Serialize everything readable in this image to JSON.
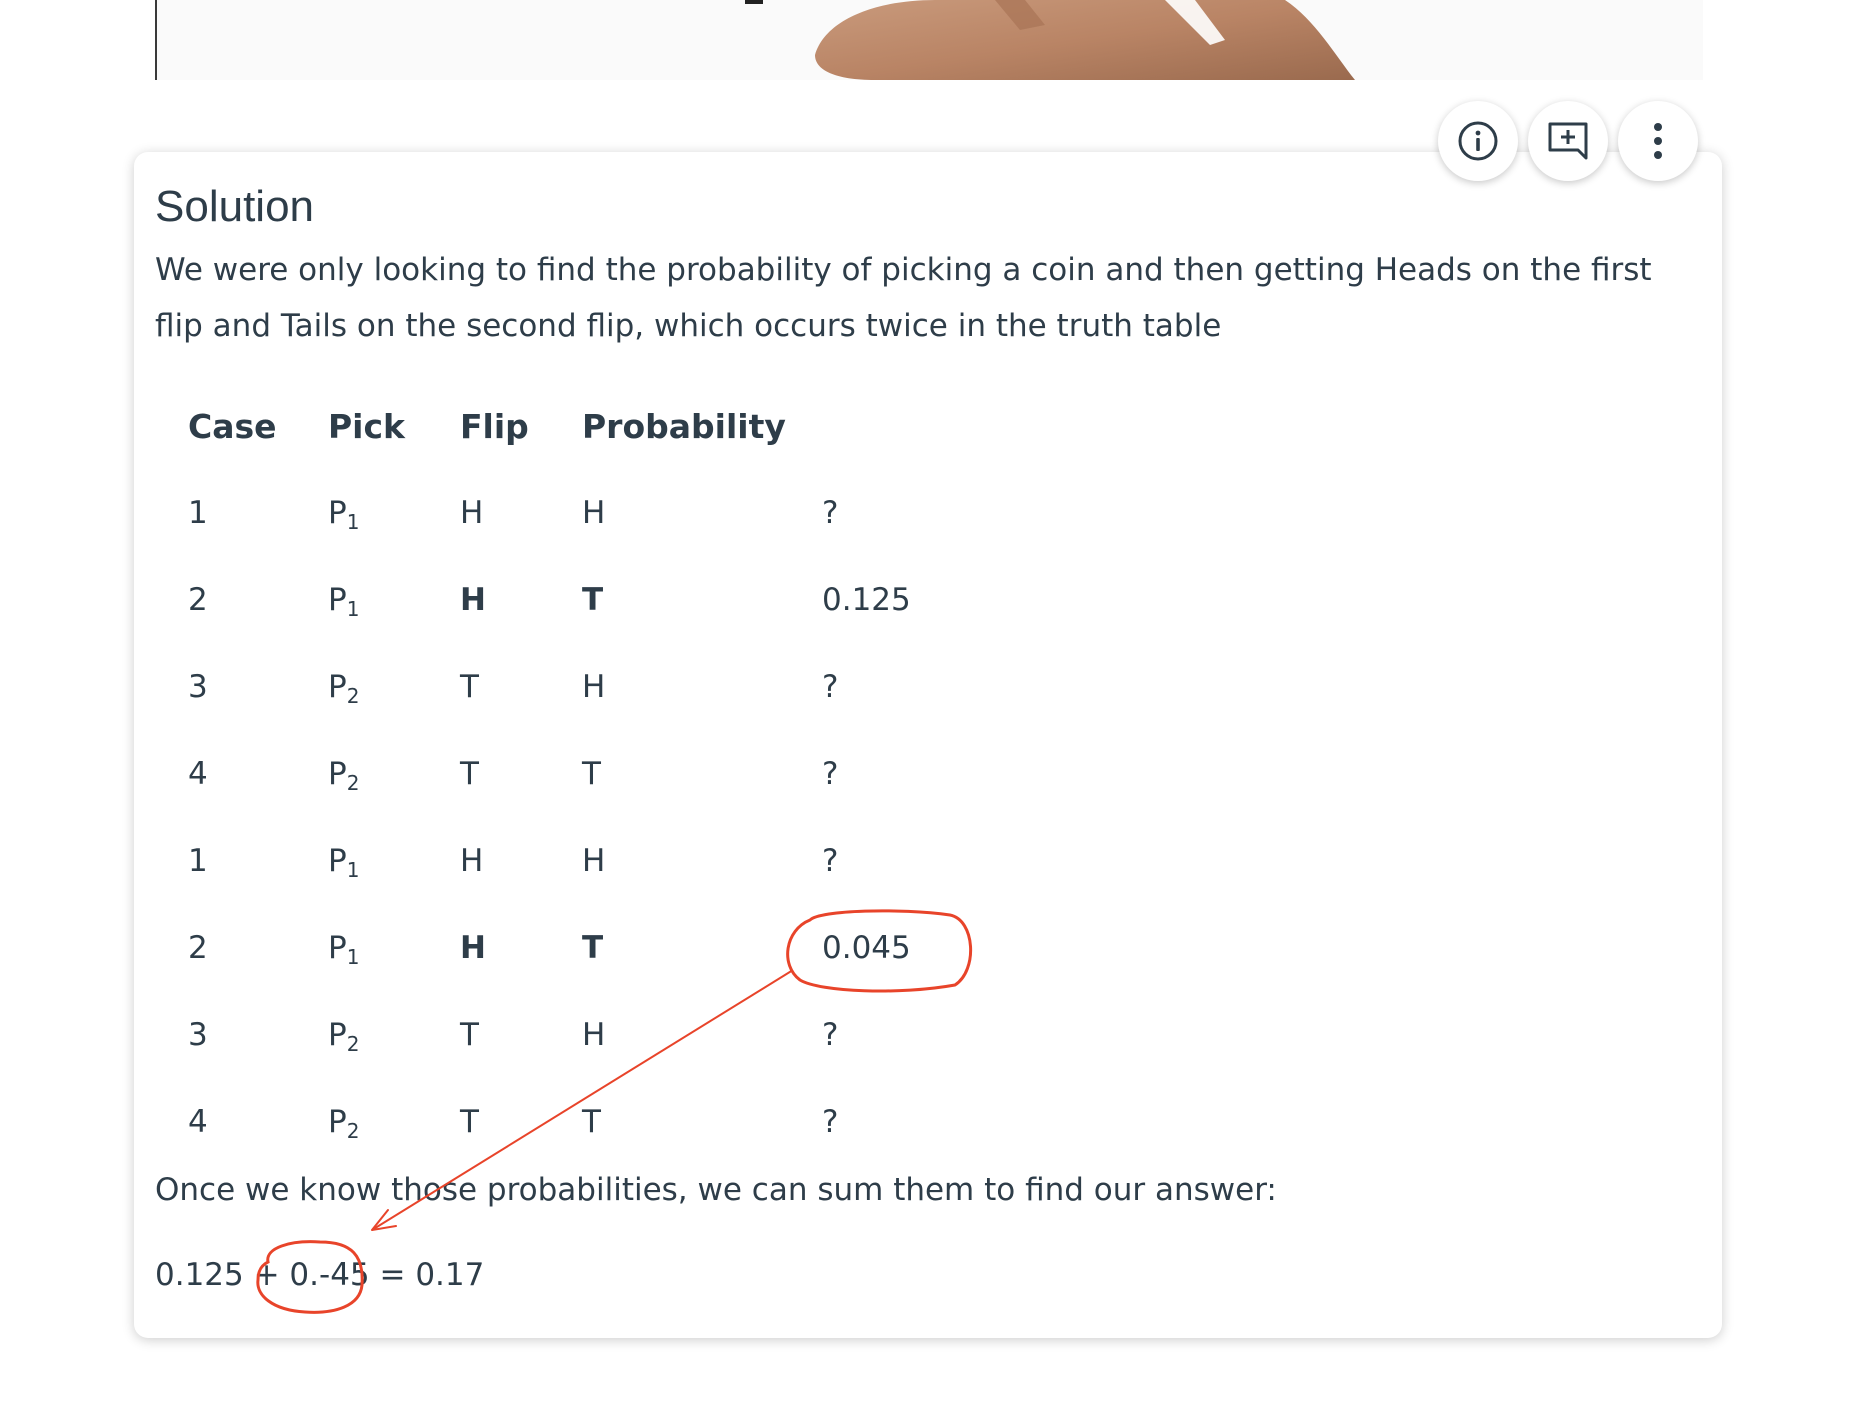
{
  "card": {
    "title": "Solution",
    "intro": "We were only looking to find the probability of picking a coin and then getting Heads on the first flip and Tails on the second flip, which occurs twice in the truth table",
    "outro": "Once we know those probabilities, we can sum them to find our answer:",
    "equation": "0.125 + 0.-45 = 0.17"
  },
  "table": {
    "headers": [
      "Case",
      "Pick",
      "Flip",
      "Probability"
    ],
    "rows": [
      {
        "case": "1",
        "pick": "P",
        "pick_sub": "1",
        "flip1": "H",
        "flip2": "H",
        "prob": "?",
        "bold": false
      },
      {
        "case": "2",
        "pick": "P",
        "pick_sub": "1",
        "flip1": "H",
        "flip2": "T",
        "prob": "0.125",
        "bold": true
      },
      {
        "case": "3",
        "pick": "P",
        "pick_sub": "2",
        "flip1": "T",
        "flip2": "H",
        "prob": "?",
        "bold": false
      },
      {
        "case": "4",
        "pick": "P",
        "pick_sub": "2",
        "flip1": "T",
        "flip2": "T",
        "prob": "?",
        "bold": false
      },
      {
        "case": "1",
        "pick": "P",
        "pick_sub": "1",
        "flip1": "H",
        "flip2": "H",
        "prob": "?",
        "bold": false
      },
      {
        "case": "2",
        "pick": "P",
        "pick_sub": "1",
        "flip1": "H",
        "flip2": "T",
        "prob": "0.045",
        "bold": true
      },
      {
        "case": "3",
        "pick": "P",
        "pick_sub": "2",
        "flip1": "T",
        "flip2": "H",
        "prob": "?",
        "bold": false
      },
      {
        "case": "4",
        "pick": "P",
        "pick_sub": "2",
        "flip1": "T",
        "flip2": "T",
        "prob": "?",
        "bold": false
      }
    ]
  },
  "actions": [
    {
      "name": "info-icon"
    },
    {
      "name": "add-note-icon"
    },
    {
      "name": "more-vertical-icon"
    }
  ],
  "colors": {
    "text": "#2e3d49",
    "annotation": "#e8442a",
    "card_bg": "#ffffff"
  }
}
